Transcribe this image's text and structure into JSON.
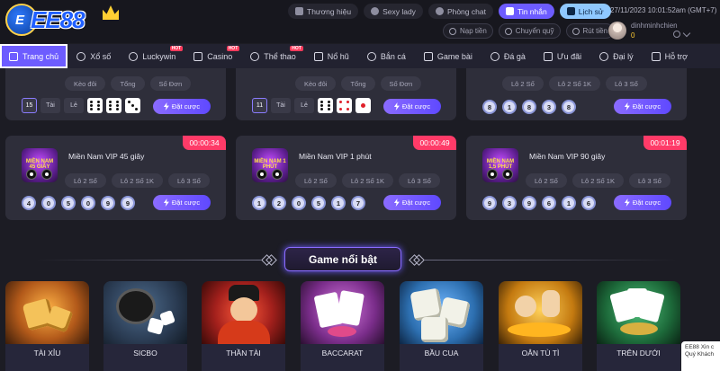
{
  "brand": {
    "logo_text": "EE88"
  },
  "top_links": [
    {
      "label": "Thương hiệu",
      "icon": "car-icon"
    },
    {
      "label": "Sexy lady",
      "icon": "play-icon"
    },
    {
      "label": "Phòng chat",
      "icon": "chat-icon"
    },
    {
      "label": "Tin nhắn",
      "icon": "message-icon"
    },
    {
      "label": "Lịch sử",
      "icon": "history-icon"
    }
  ],
  "datetime": "27/11/2023 10:01:52am  (GMT+7)",
  "account_actions": [
    {
      "label": "Nạp tiền"
    },
    {
      "label": "Chuyển quỹ"
    },
    {
      "label": "Rút tiền"
    }
  ],
  "user": {
    "name": "dinhminhchien",
    "balance": "0"
  },
  "nav": [
    {
      "label": "Trang chủ",
      "hot": ""
    },
    {
      "label": "Xổ số",
      "hot": ""
    },
    {
      "label": "Luckywin",
      "hot": "HOT"
    },
    {
      "label": "Casino",
      "hot": "HOT"
    },
    {
      "label": "Thể thao",
      "hot": "HOT"
    },
    {
      "label": "Nổ hũ",
      "hot": ""
    },
    {
      "label": "Bắn cá",
      "hot": ""
    },
    {
      "label": "Game bài",
      "hot": ""
    },
    {
      "label": "Đá gà",
      "hot": ""
    },
    {
      "label": "Ưu đãi",
      "hot": ""
    },
    {
      "label": "Đại lý",
      "hot": ""
    },
    {
      "label": "Hỗ trợ",
      "hot": ""
    }
  ],
  "bet_label": "Đặt cược",
  "top_cards": [
    {
      "pills": [
        "Kèo đôi",
        "Tổng",
        "Số Đơn"
      ],
      "total": "15",
      "chips": [
        "Tài",
        "Lẻ"
      ]
    },
    {
      "pills": [
        "Kèo đôi",
        "Tổng",
        "Số Đơn"
      ],
      "total": "11",
      "chips": [
        "Tài",
        "Lẻ"
      ]
    },
    {
      "pills": [
        "Lô 2 Số",
        "Lô 2 Số 1K",
        "Lô 3 Số"
      ],
      "balls": [
        "8",
        "1",
        "8",
        "3",
        "8"
      ]
    }
  ],
  "cards": [
    {
      "title": "Miền Nam VIP 45 giây",
      "thumb_label": "MIỀN NAM 45 GIÂY",
      "timer": "00:00:34",
      "pills": [
        "Lô 2 Số",
        "Lô 2 Số 1K",
        "Lô 3 Số"
      ],
      "balls": [
        "4",
        "0",
        "5",
        "0",
        "9",
        "9"
      ]
    },
    {
      "title": "Miền Nam VIP 1 phút",
      "thumb_label": "MIỀN NAM 1 PHÚT",
      "timer": "00:00:49",
      "pills": [
        "Lô 2 Số",
        "Lô 2 Số 1K",
        "Lô 3 Số"
      ],
      "balls": [
        "1",
        "2",
        "0",
        "5",
        "1",
        "7"
      ]
    },
    {
      "title": "Miền Nam VIP 90 giây",
      "thumb_label": "MIỀN NAM 1,5 PHÚT",
      "timer": "00:01:19",
      "pills": [
        "Lô 2 Số",
        "Lô 2 Số 1K",
        "Lô 3 Số"
      ],
      "balls": [
        "9",
        "3",
        "9",
        "6",
        "1",
        "6"
      ]
    }
  ],
  "featured": {
    "title": "Game nổi bật",
    "games": [
      {
        "name": "TÀI XỈU",
        "bg": "#b35a1a"
      },
      {
        "name": "SICBO",
        "bg": "#2a3b52"
      },
      {
        "name": "THẦN TÀI",
        "bg": "#a3201c"
      },
      {
        "name": "BACCARAT",
        "bg": "#7a2d8a"
      },
      {
        "name": "BẦU CUA",
        "bg": "#2d6fb0"
      },
      {
        "name": "OẲN TÙ TÌ",
        "bg": "#c47a10"
      },
      {
        "name": "TRÊN DƯỚI",
        "bg": "#1d6a3a"
      }
    ]
  },
  "chat_widget": {
    "text": "EE88 Xin c Quý Khách"
  }
}
